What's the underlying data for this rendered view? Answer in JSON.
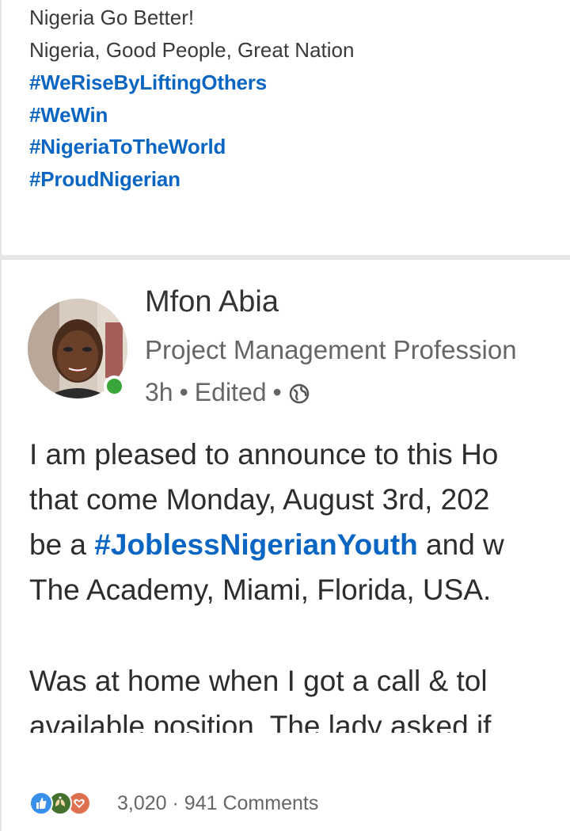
{
  "top_post": {
    "lines": [
      "Nigeria Go Better!",
      "Nigeria, Good People, Great Nation"
    ],
    "hashtags": [
      "#WeRiseByLiftingOthers",
      "#WeWin",
      "#NigeriaToTheWorld",
      "#ProudNigerian"
    ]
  },
  "post": {
    "author": "Mfon Abia",
    "headline": "Project Management Profession",
    "time": "3h",
    "edited": "Edited",
    "visibility_icon": "globe-icon",
    "body": {
      "line1": "I am pleased to announce to this Ho",
      "line2": "that come Monday, August 3rd, 202",
      "line3_before": "be a ",
      "line3_hashtag": "#JoblessNigerianYouth",
      "line3_after": " and w",
      "line4": "The Academy, Miami, Florida, USA.",
      "line5": "Was at home when I got a call & tol",
      "line6": "available position. The lady asked if"
    },
    "reactions_count": "3,020",
    "comments": "941 Comments"
  },
  "colors": {
    "accent": "#0a66c2",
    "presence": "#3aa53a",
    "like": "#378fe9",
    "celebrate": "#44712e",
    "love": "#df704d"
  }
}
